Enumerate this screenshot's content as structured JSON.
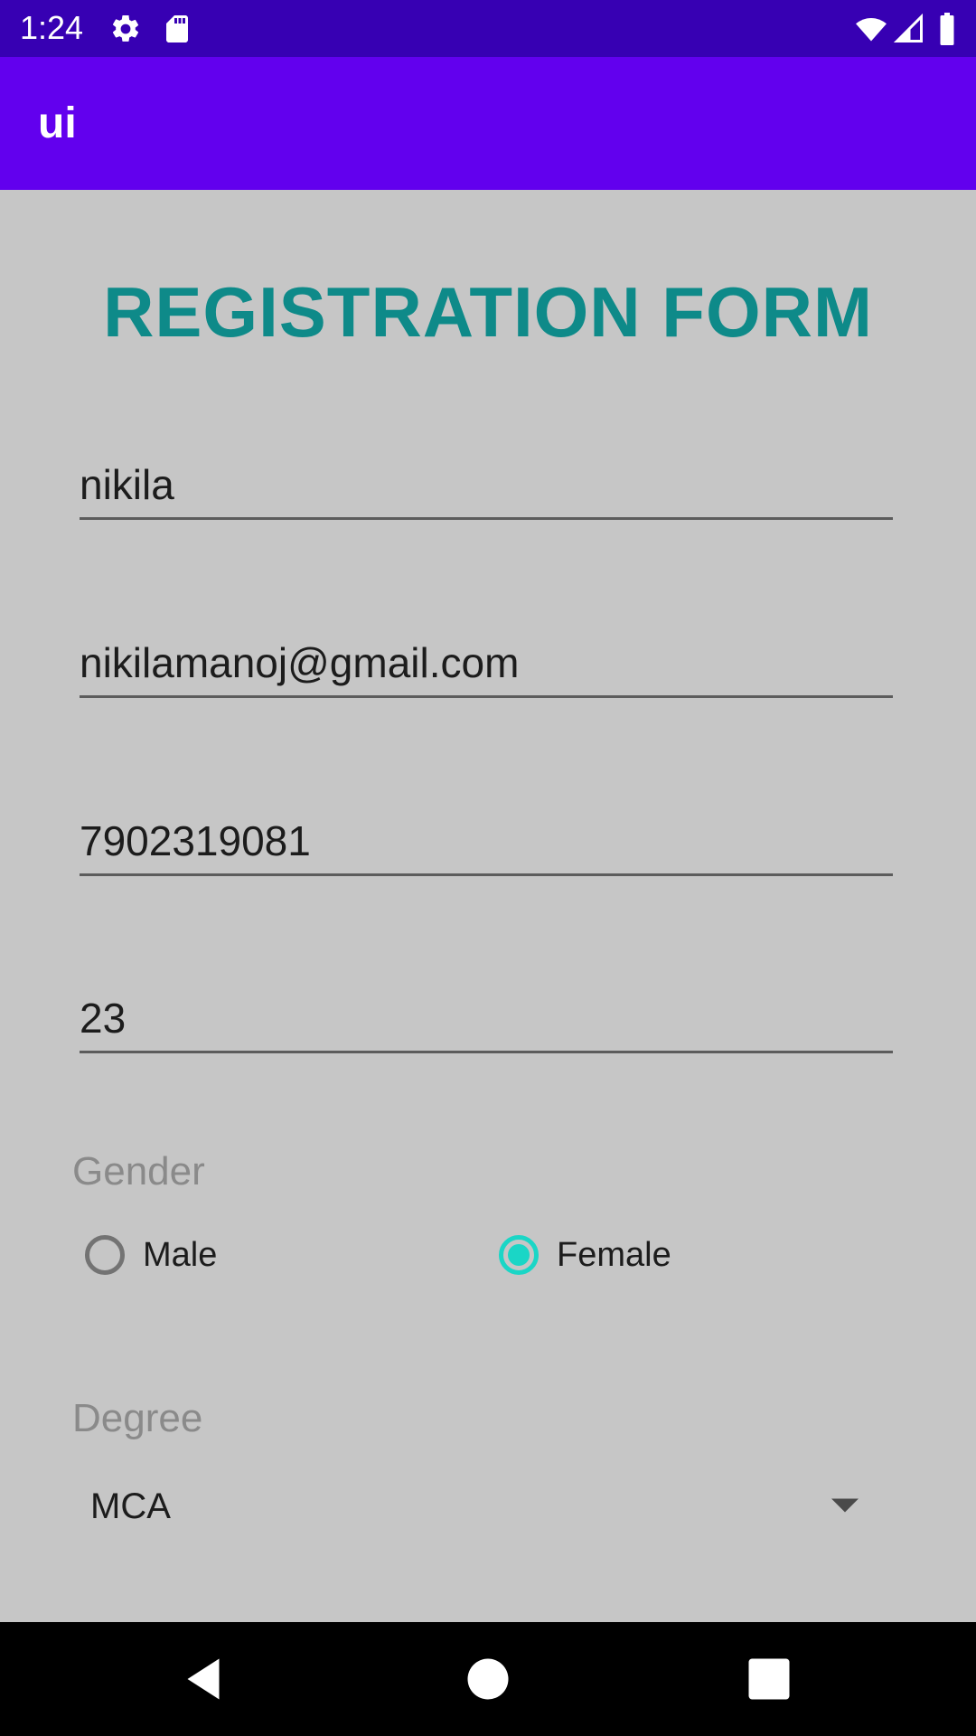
{
  "status_bar": {
    "time": "1:24",
    "left_icons": [
      "gear-icon",
      "sd-card-icon"
    ],
    "right_icons": [
      "wifi-icon",
      "signal-icon",
      "battery-icon"
    ],
    "color": "#3700b3"
  },
  "app_bar": {
    "title": "ui",
    "color": "#6200ee"
  },
  "form": {
    "title": "REGISTRATION FORM",
    "title_color": "#0e8a89",
    "fields": {
      "name": "nikila",
      "email": "nikilamanoj@gmail.com",
      "phone": "7902319081",
      "age": "23"
    },
    "gender": {
      "label": "Gender",
      "options": [
        {
          "label": "Male",
          "checked": false
        },
        {
          "label": "Female",
          "checked": true
        }
      ],
      "accent_color": "#1ad6c6"
    },
    "degree": {
      "label": "Degree",
      "selected": "MCA"
    }
  },
  "nav_bar": {
    "buttons": [
      "back-icon",
      "home-icon",
      "recents-icon"
    ]
  }
}
